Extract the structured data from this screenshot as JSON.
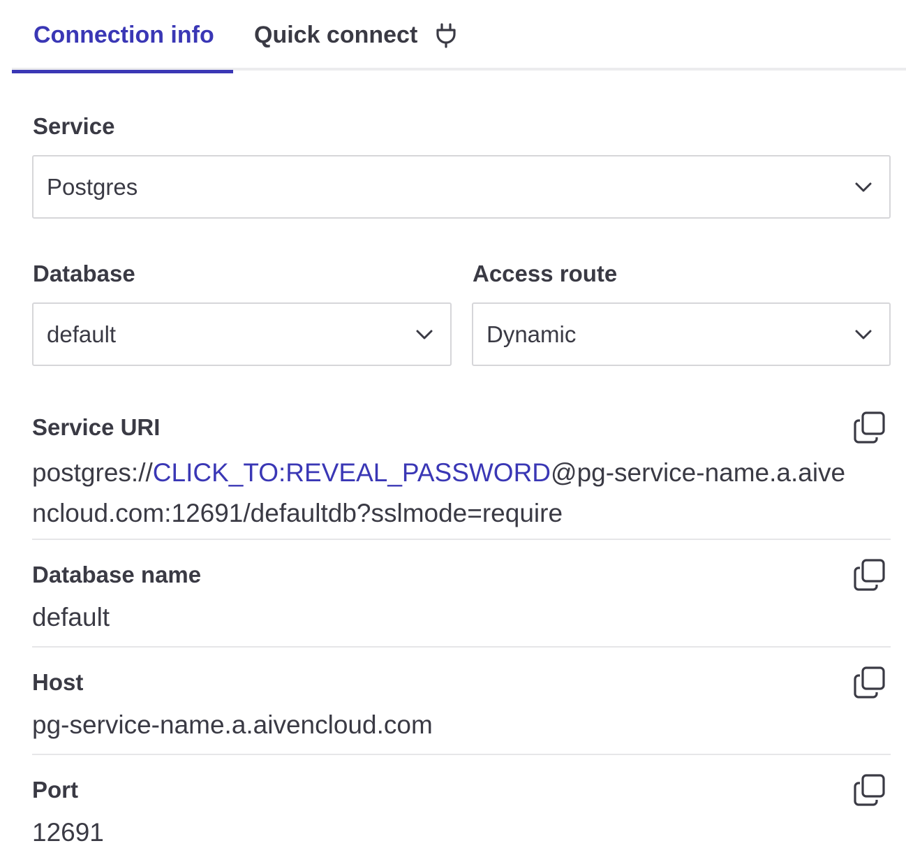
{
  "tabs": {
    "connection_info": "Connection info",
    "quick_connect": "Quick connect"
  },
  "service": {
    "label": "Service",
    "value": "Postgres"
  },
  "database": {
    "label": "Database",
    "value": "default"
  },
  "access_route": {
    "label": "Access route",
    "value": "Dynamic"
  },
  "service_uri": {
    "label": "Service URI",
    "prefix": "postgres://",
    "password_link": "CLICK_TO:REVEAL_PASSWORD",
    "suffix": "@pg-service-name.a.aivencloud.com:12691/defaultdb?sslmode=require"
  },
  "database_name": {
    "label": "Database name",
    "value": "default"
  },
  "host": {
    "label": "Host",
    "value": "pg-service-name.a.aivencloud.com"
  },
  "port": {
    "label": "Port",
    "value": "12691"
  },
  "colors": {
    "accent": "#3a37b5",
    "text": "#3a3a44",
    "border": "#d6d6d9",
    "divider": "#e6e6e8"
  },
  "icons": {
    "quick_connect": "plug-icon",
    "dropdown": "chevron-down-icon",
    "copy": "copy-icon"
  }
}
